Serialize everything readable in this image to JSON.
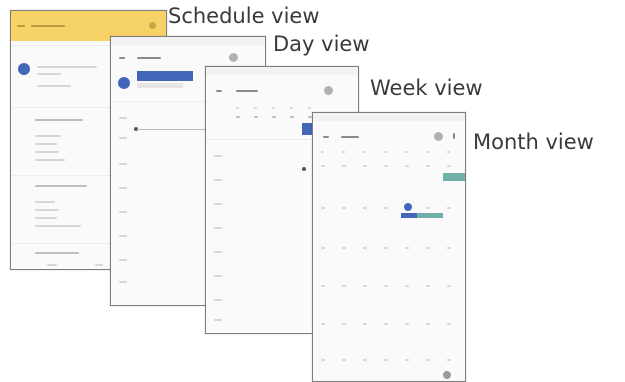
{
  "labels": {
    "schedule": "Schedule view",
    "day": "Day view",
    "week": "Week view",
    "month": "Month view"
  },
  "colors": {
    "accent_yellow": "#f7d267",
    "accent_blue": "#4466b8",
    "accent_teal": "#6fb0a8",
    "frame": "#7d7d7d"
  }
}
